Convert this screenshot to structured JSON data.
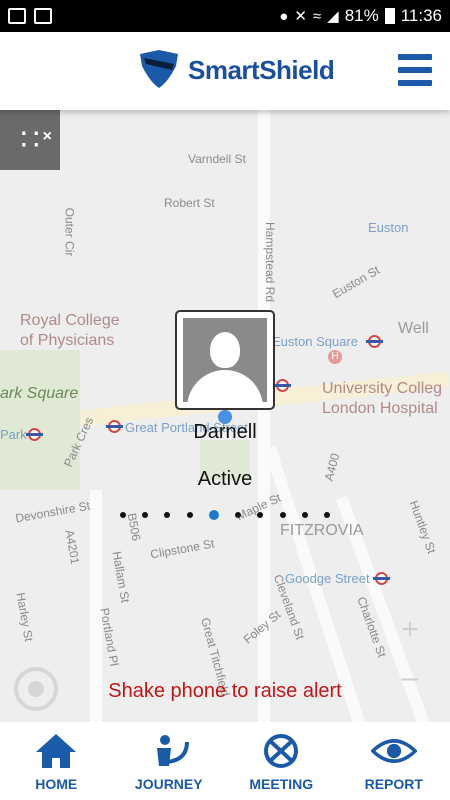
{
  "status_bar": {
    "battery": "81%",
    "time": "11:36"
  },
  "header": {
    "brand_name": "SmartShield"
  },
  "map": {
    "labels": {
      "varndell": "Varndell St",
      "robert": "Robert St",
      "euston": "Euston",
      "euston_st": "Euston St",
      "hampstead": "Hampstead Rd",
      "royal_college": "Royal College",
      "of_physicians": "of Physicians",
      "euston_square": "Euston Square",
      "wellcome": "Well",
      "ark_square": "ark Square",
      "park": "Park",
      "park_cres": "Park Cres",
      "great_portland": "Great Portland Street",
      "university_college": "University Colleg",
      "london_hospital": "London Hospital",
      "a400": "A400",
      "devonshire": "Devonshire St",
      "fitzrovia": "FITZROVIA",
      "maple": "Maple St",
      "huntley": "Huntley St",
      "a4201": "A4201",
      "clipstone": "Clipstone St",
      "hallam": "Hallam St",
      "b506": "B506",
      "goodge": "Goodge Street",
      "cleveland": "Cleveland St",
      "foley": "Foley St",
      "charlotte": "Charlotte St",
      "harley": "Harley St",
      "portland_pl": "Portland Pl",
      "outer_cir": "Outer Cir",
      "great_titchfield": "Great Titchfield"
    }
  },
  "contact": {
    "name": "Darnell",
    "status": "Active",
    "pager_total": 10,
    "pager_active_index": 4
  },
  "alert_hint": "Shake phone to raise alert",
  "nav": {
    "home": "HOME",
    "journey": "JOURNEY",
    "meeting": "MEETING",
    "report": "REPORT"
  },
  "colors": {
    "brand": "#1a5aa8",
    "alert": "#c21515",
    "pager_active": "#1a7ad0"
  }
}
